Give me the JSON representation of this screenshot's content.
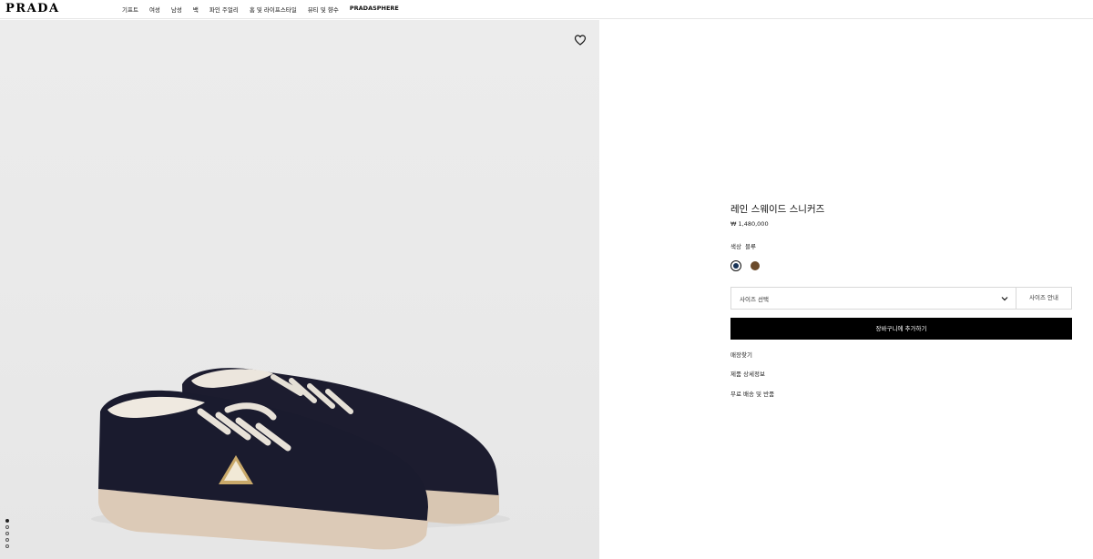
{
  "header": {
    "logo": "PRADA",
    "nav": [
      "기프트",
      "여성",
      "남성",
      "백",
      "파인 주얼리",
      "홈 및 라이프스타일",
      "뷰티 및 향수",
      "PRADASPHERE"
    ]
  },
  "gallery": {
    "dots": 5,
    "active_dot": 0,
    "wishlist_icon": "heart-icon",
    "colors": {
      "background": "#ebebeb",
      "suede": "#1a1b2e",
      "sole": "#dccab7"
    }
  },
  "product": {
    "title": "레인 스웨이드 스니커즈",
    "price": "₩ 1,480,000",
    "color_label": "색상",
    "color_value": "블루",
    "swatches": [
      {
        "name": "블루",
        "color": "#173255",
        "selected": true
      },
      {
        "name": "brown",
        "color": "#6b4a2a",
        "selected": false
      }
    ],
    "size_placeholder": "사이즈 선택",
    "size_guide": "사이즈 안내",
    "add_to_cart": "장바구니에 추가하기",
    "links": [
      "매장찾기",
      "제품 상세정보",
      "무료 배송 및 반품"
    ]
  }
}
